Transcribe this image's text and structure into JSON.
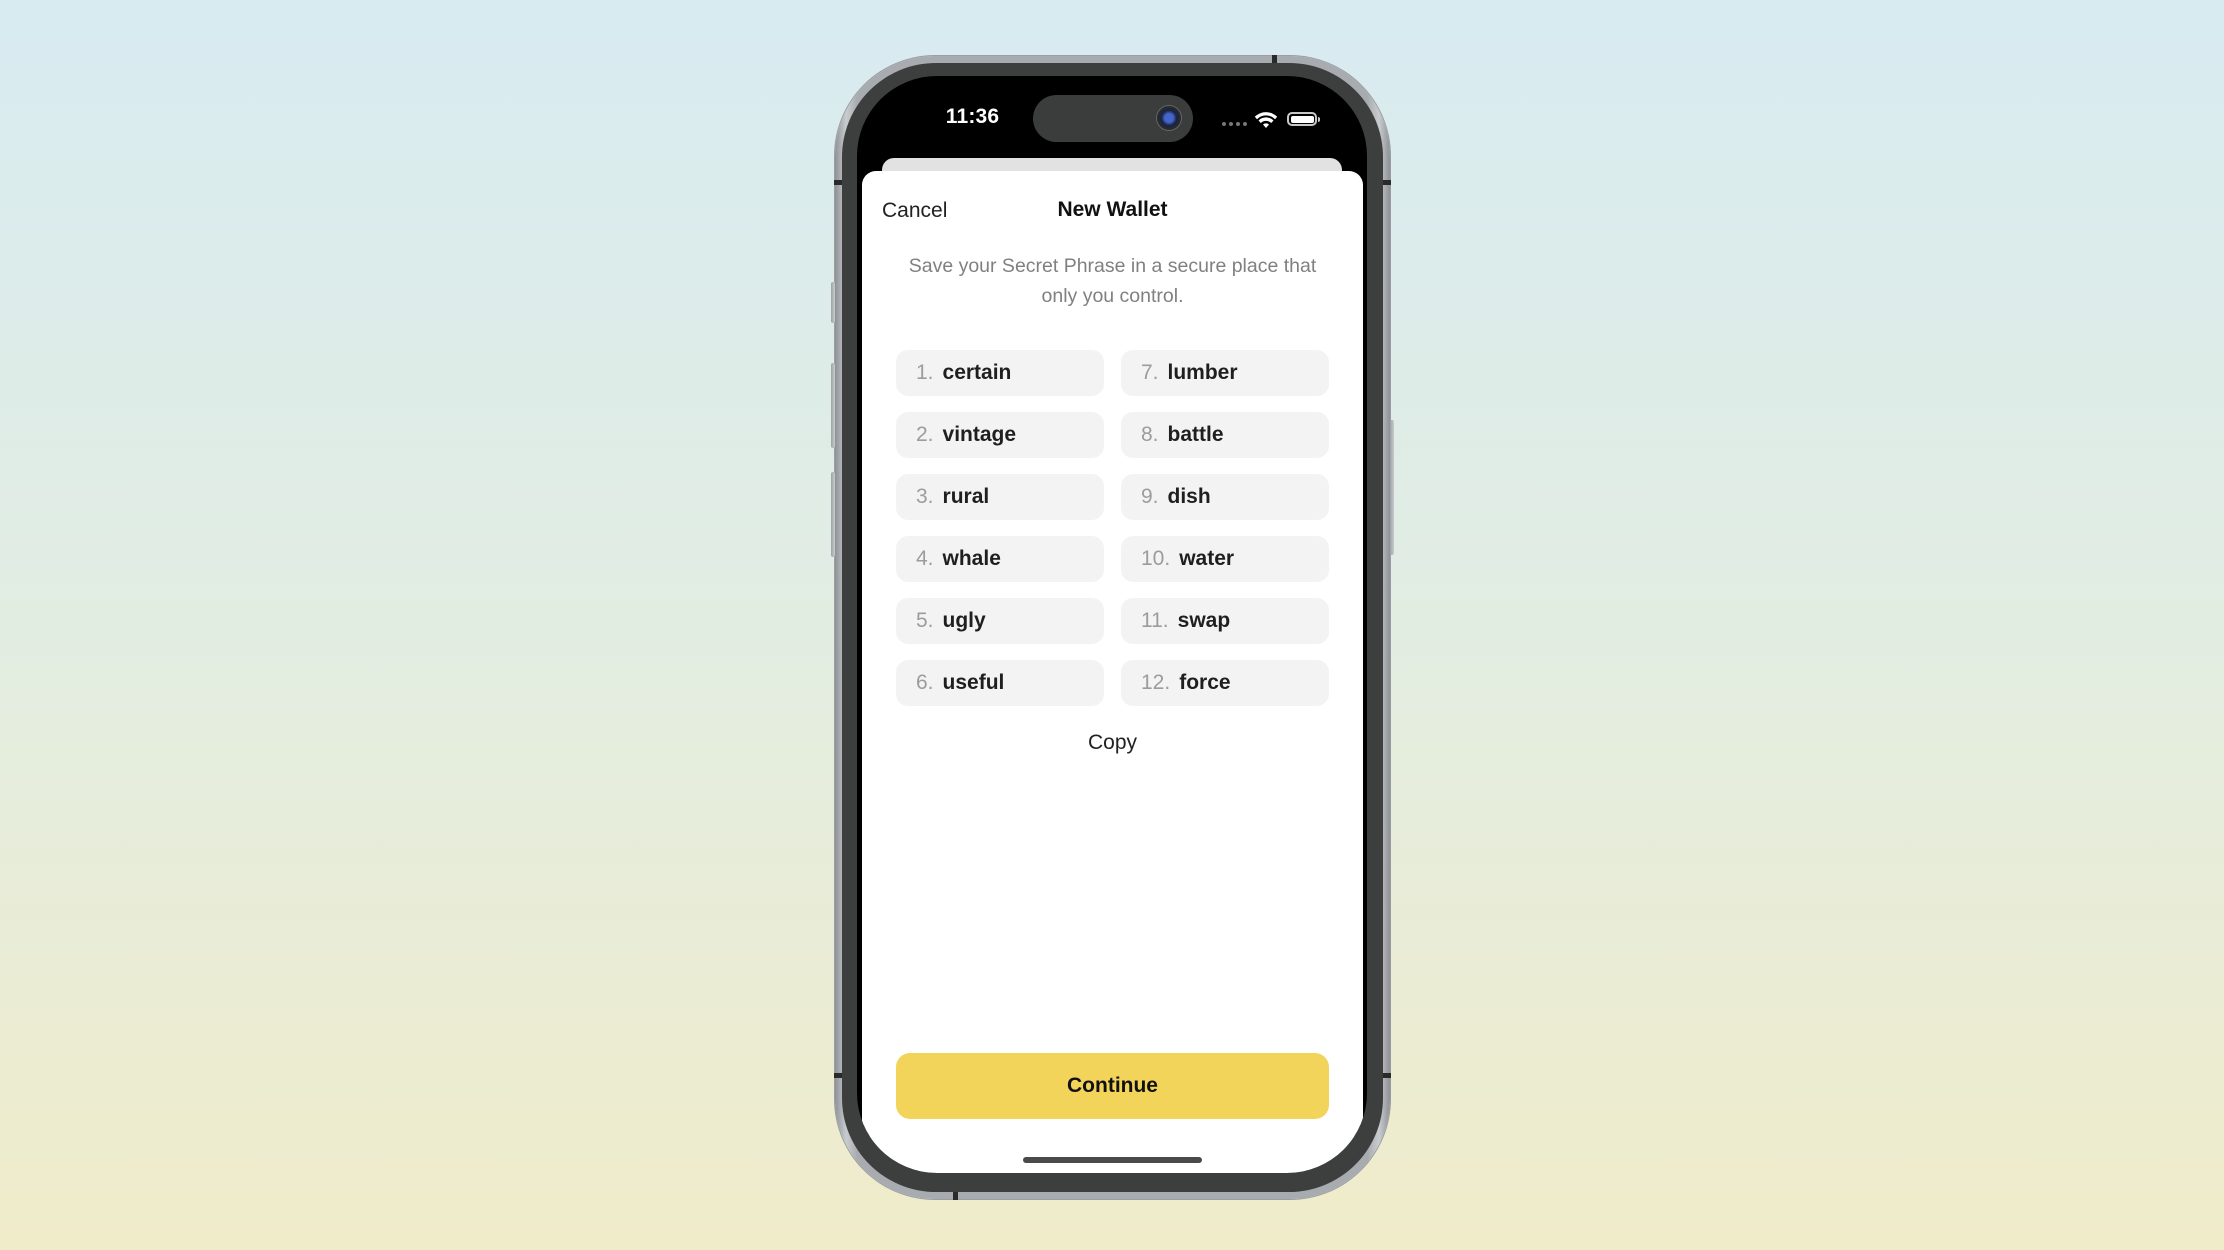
{
  "status_bar": {
    "time": "11:36",
    "icons": [
      "cellular-dots-icon",
      "wifi-icon",
      "battery-icon"
    ]
  },
  "nav": {
    "cancel_label": "Cancel",
    "title": "New Wallet"
  },
  "subtitle": "Save your Secret Phrase in a secure place that only you control.",
  "secret_phrase": [
    {
      "num": "1.",
      "word": "certain"
    },
    {
      "num": "2.",
      "word": "vintage"
    },
    {
      "num": "3.",
      "word": "rural"
    },
    {
      "num": "4.",
      "word": "whale"
    },
    {
      "num": "5.",
      "word": "ugly"
    },
    {
      "num": "6.",
      "word": "useful"
    },
    {
      "num": "7.",
      "word": "lumber"
    },
    {
      "num": "8.",
      "word": "battle"
    },
    {
      "num": "9.",
      "word": "dish"
    },
    {
      "num": "10.",
      "word": "water"
    },
    {
      "num": "11.",
      "word": "swap"
    },
    {
      "num": "12.",
      "word": "force"
    }
  ],
  "copy_label": "Copy",
  "continue_label": "Continue",
  "colors": {
    "accent": "#F3D45B",
    "chip_background": "#F3F3F3",
    "subtitle_text": "#808080"
  }
}
